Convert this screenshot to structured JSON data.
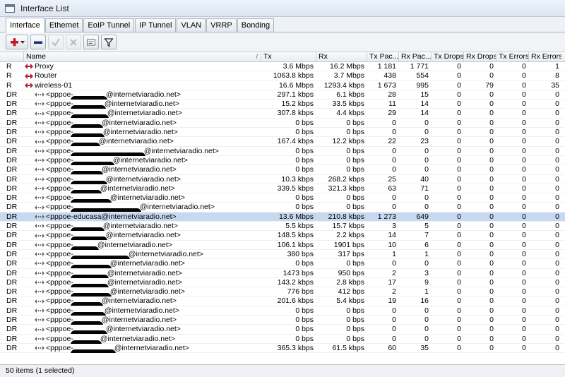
{
  "window": {
    "title": "Interface List"
  },
  "tabs": [
    {
      "label": "Interface",
      "active": true
    },
    {
      "label": "Ethernet"
    },
    {
      "label": "EoIP Tunnel"
    },
    {
      "label": "IP Tunnel"
    },
    {
      "label": "VLAN"
    },
    {
      "label": "VRRP"
    },
    {
      "label": "Bonding"
    }
  ],
  "toolbar": {
    "buttons": [
      "add-icon",
      "remove-icon",
      "enable-icon",
      "disable-icon",
      "comment-icon",
      "filter-icon"
    ]
  },
  "columns": [
    "Name",
    "Tx",
    "Rx",
    "Tx Pac...",
    "Rx Pac...",
    "Tx Drops",
    "Rx Drops",
    "Tx Errors",
    "Rx Errors"
  ],
  "rows": [
    {
      "flag": "R",
      "name": "Proxy",
      "kind": "ether",
      "tx": "3.6 Mbps",
      "rx": "16.2 Mbps",
      "txp": "1 181",
      "rxp": "1 771",
      "txd": "0",
      "rxd": "0",
      "txe": "0",
      "rxe": "1"
    },
    {
      "flag": "R",
      "name": "Router",
      "kind": "ether",
      "tx": "1063.8 kbps",
      "rx": "3.7 Mbps",
      "txp": "438",
      "rxp": "554",
      "txd": "0",
      "rxd": "0",
      "txe": "0",
      "rxe": "8"
    },
    {
      "flag": "R",
      "name": "wireless-01",
      "kind": "ether",
      "tx": "16.6 Mbps",
      "rx": "1293.4 kbps",
      "txp": "1 673",
      "rxp": "995",
      "txd": "0",
      "rxd": "79",
      "txe": "0",
      "rxe": "35"
    },
    {
      "flag": "DR",
      "name": "<pppoe-",
      "suffix": "@internetviaradio.net>",
      "kind": "ppp",
      "tx": "297.1 kbps",
      "rx": "6.1 kbps",
      "txp": "28",
      "rxp": "15",
      "txd": "0",
      "rxd": "0",
      "txe": "0",
      "rxe": "0"
    },
    {
      "flag": "DR",
      "name": "<pppoe-",
      "suffix": "@internetviaradio.net>",
      "kind": "ppp",
      "tx": "15.2 kbps",
      "rx": "33.5 kbps",
      "txp": "11",
      "rxp": "14",
      "txd": "0",
      "rxd": "0",
      "txe": "0",
      "rxe": "0"
    },
    {
      "flag": "DR",
      "name": "<pppoe-",
      "suffix": "@internetviaradio.net>",
      "kind": "ppp",
      "tx": "307.8 kbps",
      "rx": "4.4 kbps",
      "txp": "29",
      "rxp": "14",
      "txd": "0",
      "rxd": "0",
      "txe": "0",
      "rxe": "0"
    },
    {
      "flag": "DR",
      "name": "<pppoe-",
      "suffix": "@internetviaradio.net>",
      "kind": "ppp",
      "tx": "0 bps",
      "rx": "0 bps",
      "txp": "0",
      "rxp": "0",
      "txd": "0",
      "rxd": "0",
      "txe": "0",
      "rxe": "0"
    },
    {
      "flag": "DR",
      "name": "<pppoe-",
      "suffix": "@internetviaradio.net>",
      "kind": "ppp",
      "tx": "0 bps",
      "rx": "0 bps",
      "txp": "0",
      "rxp": "0",
      "txd": "0",
      "rxd": "0",
      "txe": "0",
      "rxe": "0"
    },
    {
      "flag": "DR",
      "name": "<pppoe-",
      "suffix": "@internetviaradio.net>",
      "kind": "ppp",
      "tx": "167.4 kbps",
      "rx": "12.2 kbps",
      "txp": "22",
      "rxp": "23",
      "txd": "0",
      "rxd": "0",
      "txe": "0",
      "rxe": "0"
    },
    {
      "flag": "DR",
      "name": "<pppoe-",
      "suffix": "@internetviaradio.net>",
      "kind": "ppp",
      "tx": "0 bps",
      "rx": "0 bps",
      "txp": "0",
      "rxp": "0",
      "txd": "0",
      "rxd": "0",
      "txe": "0",
      "rxe": "0"
    },
    {
      "flag": "DR",
      "name": "<pppoe-",
      "suffix": "@internetviaradio.net>",
      "kind": "ppp",
      "tx": "0 bps",
      "rx": "0 bps",
      "txp": "0",
      "rxp": "0",
      "txd": "0",
      "rxd": "0",
      "txe": "0",
      "rxe": "0"
    },
    {
      "flag": "DR",
      "name": "<pppoe-",
      "suffix": "@internetviaradio.net>",
      "kind": "ppp",
      "tx": "0 bps",
      "rx": "0 bps",
      "txp": "0",
      "rxp": "0",
      "txd": "0",
      "rxd": "0",
      "txe": "0",
      "rxe": "0"
    },
    {
      "flag": "DR",
      "name": "<pppoe-",
      "suffix": "@internetviaradio.net>",
      "kind": "ppp",
      "tx": "10.3 kbps",
      "rx": "268.2 kbps",
      "txp": "25",
      "rxp": "40",
      "txd": "0",
      "rxd": "0",
      "txe": "0",
      "rxe": "0"
    },
    {
      "flag": "DR",
      "name": "<pppoe-",
      "suffix": "@internetviaradio.net>",
      "kind": "ppp",
      "tx": "339.5 kbps",
      "rx": "321.3 kbps",
      "txp": "63",
      "rxp": "71",
      "txd": "0",
      "rxd": "0",
      "txe": "0",
      "rxe": "0"
    },
    {
      "flag": "DR",
      "name": "<pppoe-",
      "suffix": "@internetviaradio.net>",
      "kind": "ppp",
      "tx": "0 bps",
      "rx": "0 bps",
      "txp": "0",
      "rxp": "0",
      "txd": "0",
      "rxd": "0",
      "txe": "0",
      "rxe": "0"
    },
    {
      "flag": "DR",
      "name": "<pppoe-",
      "suffix": "@internetviaradio.net>",
      "kind": "ppp",
      "tx": "0 bps",
      "rx": "0 bps",
      "txp": "0",
      "rxp": "0",
      "txd": "0",
      "rxd": "0",
      "txe": "0",
      "rxe": "0"
    },
    {
      "flag": "DR",
      "name": "<pppoe-educasa@internetviaradio.net>",
      "suffix": "",
      "kind": "ppp",
      "selected": true,
      "tx": "13.6 Mbps",
      "rx": "210.8 kbps",
      "txp": "1 273",
      "rxp": "649",
      "txd": "0",
      "rxd": "0",
      "txe": "0",
      "rxe": "0"
    },
    {
      "flag": "DR",
      "name": "<pppoe-",
      "suffix": "@internetviaradio.net>",
      "kind": "ppp",
      "tx": "5.5 kbps",
      "rx": "15.7 kbps",
      "txp": "3",
      "rxp": "5",
      "txd": "0",
      "rxd": "0",
      "txe": "0",
      "rxe": "0"
    },
    {
      "flag": "DR",
      "name": "<pppoe-",
      "suffix": "@internetviaradio.net>",
      "kind": "ppp",
      "tx": "148.5 kbps",
      "rx": "2.2 kbps",
      "txp": "14",
      "rxp": "7",
      "txd": "0",
      "rxd": "0",
      "txe": "0",
      "rxe": "0"
    },
    {
      "flag": "DR",
      "name": "<pppoe-",
      "suffix": "@internetviaradio.net>",
      "kind": "ppp",
      "tx": "106.1 kbps",
      "rx": "1901 bps",
      "txp": "10",
      "rxp": "6",
      "txd": "0",
      "rxd": "0",
      "txe": "0",
      "rxe": "0"
    },
    {
      "flag": "DR",
      "name": "<pppoe-",
      "suffix": "@internetviaradio.net>",
      "kind": "ppp",
      "tx": "380 bps",
      "rx": "317 bps",
      "txp": "1",
      "rxp": "1",
      "txd": "0",
      "rxd": "0",
      "txe": "0",
      "rxe": "0"
    },
    {
      "flag": "DR",
      "name": "<pppoe-",
      "suffix": "@internetviaradio.net>",
      "kind": "ppp",
      "tx": "0 bps",
      "rx": "0 bps",
      "txp": "0",
      "rxp": "0",
      "txd": "0",
      "rxd": "0",
      "txe": "0",
      "rxe": "0"
    },
    {
      "flag": "DR",
      "name": "<pppoe-",
      "suffix": "@internetviaradio.net>",
      "kind": "ppp",
      "tx": "1473 bps",
      "rx": "950 bps",
      "txp": "2",
      "rxp": "3",
      "txd": "0",
      "rxd": "0",
      "txe": "0",
      "rxe": "0"
    },
    {
      "flag": "DR",
      "name": "<pppoe-",
      "suffix": "@internetviaradio.net>",
      "kind": "ppp",
      "tx": "143.2 kbps",
      "rx": "2.8 kbps",
      "txp": "17",
      "rxp": "9",
      "txd": "0",
      "rxd": "0",
      "txe": "0",
      "rxe": "0"
    },
    {
      "flag": "DR",
      "name": "<pppoe-",
      "suffix": "@internetviaradio.net>",
      "kind": "ppp",
      "tx": "776 bps",
      "rx": "412 bps",
      "txp": "2",
      "rxp": "1",
      "txd": "0",
      "rxd": "0",
      "txe": "0",
      "rxe": "0"
    },
    {
      "flag": "DR",
      "name": "<pppoe-",
      "suffix": "@internetviaradio.net>",
      "kind": "ppp",
      "tx": "201.6 kbps",
      "rx": "5.4 kbps",
      "txp": "19",
      "rxp": "16",
      "txd": "0",
      "rxd": "0",
      "txe": "0",
      "rxe": "0"
    },
    {
      "flag": "DR",
      "name": "<pppoe-",
      "suffix": "@internetviaradio.net>",
      "kind": "ppp",
      "tx": "0 bps",
      "rx": "0 bps",
      "txp": "0",
      "rxp": "0",
      "txd": "0",
      "rxd": "0",
      "txe": "0",
      "rxe": "0"
    },
    {
      "flag": "DR",
      "name": "<pppoe-",
      "suffix": "@internetviaradio.net>",
      "kind": "ppp",
      "tx": "0 bps",
      "rx": "0 bps",
      "txp": "0",
      "rxp": "0",
      "txd": "0",
      "rxd": "0",
      "txe": "0",
      "rxe": "0"
    },
    {
      "flag": "DR",
      "name": "<pppoe-",
      "suffix": "@internetviaradio.net>",
      "kind": "ppp",
      "tx": "0 bps",
      "rx": "0 bps",
      "txp": "0",
      "rxp": "0",
      "txd": "0",
      "rxd": "0",
      "txe": "0",
      "rxe": "0"
    },
    {
      "flag": "DR",
      "name": "<pppoe-",
      "suffix": "@internetviaradio.net>",
      "kind": "ppp",
      "tx": "0 bps",
      "rx": "0 bps",
      "txp": "0",
      "rxp": "0",
      "txd": "0",
      "rxd": "0",
      "txe": "0",
      "rxe": "0"
    },
    {
      "flag": "DR",
      "name": "<pppoe-",
      "suffix": "@internetviaradio.net>",
      "kind": "ppp",
      "tx": "365.3 kbps",
      "rx": "61.5 kbps",
      "txp": "60",
      "rxp": "35",
      "txd": "0",
      "rxd": "0",
      "txe": "0",
      "rxe": "0"
    }
  ],
  "status": {
    "text": "50 items (1 selected)"
  },
  "colors": {
    "selected_row": "#c7d9f1",
    "icon_red": "#c0191c",
    "icon_navy": "#1b2f6e"
  }
}
